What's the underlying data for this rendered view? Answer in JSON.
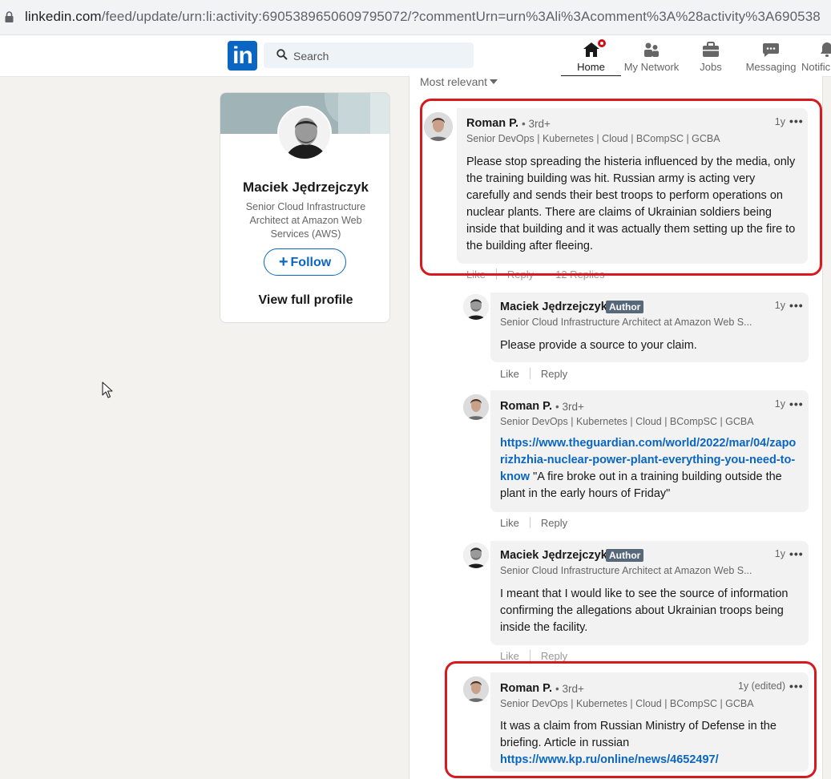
{
  "browser": {
    "url_main": "linkedin.com",
    "url_rest": "/feed/update/urn:li:activity:6905389650609795072/?commentUrn=urn%3Ali%3Acomment%3A%28activity%3A690538"
  },
  "nav": {
    "search_placeholder": "Search",
    "logo_text": "in",
    "items": [
      {
        "label": "Home",
        "icon": "home-icon"
      },
      {
        "label": "My Network",
        "icon": "network-icon"
      },
      {
        "label": "Jobs",
        "icon": "briefcase-icon"
      },
      {
        "label": "Messaging",
        "icon": "messaging-icon"
      },
      {
        "label": "Notific",
        "icon": "bell-icon"
      }
    ]
  },
  "profile": {
    "name": "Maciek Jędrzejczyk",
    "headline": "Senior Cloud Infrastructure Architect at Amazon Web Services (AWS)",
    "follow_label": "Follow",
    "view_profile_label": "View full profile"
  },
  "sort": {
    "label": "Most relevant"
  },
  "actions": {
    "like": "Like",
    "reply": "Reply",
    "replies_count": "12 Replies"
  },
  "comments": [
    {
      "name": "Roman P.",
      "degree": "• 3rd+",
      "headline": "Senior DevOps | Kubernetes | Cloud | BCompSC | GCBA",
      "time": "1y",
      "text": "Please stop spreading the histeria influenced by the media, only the training building was hit. Russian army is acting very carefully and sends their best troops to perform operations on nuclear plants. There are claims of Ukrainian soldiers being inside that building and it was actually them setting up the fire to the building after fleeing."
    },
    {
      "name": "Maciek Jędrzejczyk",
      "badge": "Author",
      "headline": "Senior Cloud Infrastructure Architect at Amazon Web S...",
      "time": "1y",
      "text": "Please provide a source to your claim."
    },
    {
      "name": "Roman P.",
      "degree": "• 3rd+",
      "headline": "Senior DevOps | Kubernetes | Cloud | BCompSC | GCBA",
      "time": "1y",
      "link": "https://www.theguardian.com/world/2022/mar/04/zaporizhzhia-nuclear-power-plant-everything-you-need-to-know",
      "text": "\"A fire broke out in a training building outside the plant in the early hours of Friday\""
    },
    {
      "name": "Maciek Jędrzejczyk",
      "badge": "Author",
      "headline": "Senior Cloud Infrastructure Architect at Amazon Web S...",
      "time": "1y",
      "text": "I meant that I would like to see the source of information confirming the allegations about Ukrainian troops being inside the facility."
    },
    {
      "name": "Roman P.",
      "degree": "• 3rd+",
      "headline": "Senior DevOps | Kubernetes | Cloud | BCompSC | GCBA",
      "time": "1y (edited)",
      "text": "It was a claim from Russian Ministry of Defense in the briefing. Article in russian",
      "link": "https://www.kp.ru/online/news/4652497/"
    }
  ],
  "colors": {
    "brand": "#0a66c2",
    "highlight": "#d71920",
    "author_badge": "#56687a"
  }
}
